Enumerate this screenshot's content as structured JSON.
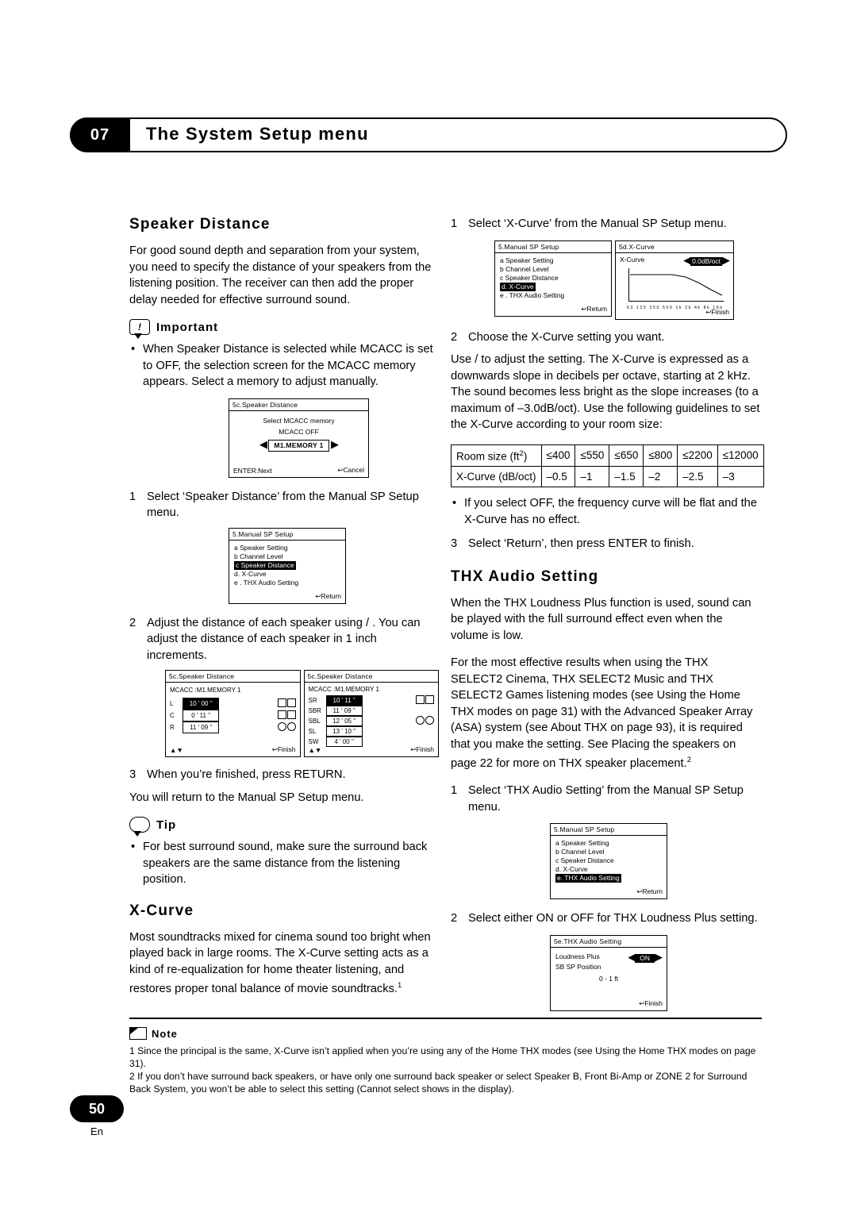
{
  "header": {
    "chapter": "07",
    "title": "The System Setup menu"
  },
  "page": {
    "number": "50",
    "lang": "En"
  },
  "left": {
    "speaker_distance": {
      "heading": "Speaker Distance",
      "intro": "For good sound depth and separation from your system, you need to specify the distance of your speakers from the listening position. The receiver can then add the proper delay needed for effective surround sound.",
      "important_label": "Important",
      "important_bullet": "When Speaker Distance is selected while MCACC is set to OFF, the selection screen for the MCACC memory appears. Select a memory to adjust manually.",
      "mcacc_screen": {
        "title": "5c.Speaker Distance",
        "line1": "Select MCACC memory",
        "memory": "M1.MEMORY 1",
        "off": "MCACC  OFF",
        "enter": "ENTER:Next",
        "cancel": "Cancel"
      },
      "step1": {
        "num": "1",
        "text": "Select ‘Speaker Distance’ from the Manual SP Setup menu."
      },
      "menu_screen": {
        "title": "5.Manual SP Setup",
        "a": "a Speaker Setting",
        "b": "b Channel Level",
        "c": "c Speaker Distance",
        "d": "d. X-Curve",
        "e": "e . THX  Audio  Setting",
        "return": "Return"
      },
      "step2": {
        "num": "2",
        "text": "Adjust the distance of each speaker using  /  . You can adjust the distance of each speaker in 1 inch increments."
      },
      "dist_screen_left": {
        "title": "5c.Speaker Distance",
        "mcacc": "MCACC  :M1.MEMORY  1",
        "rows": [
          {
            "label": "L",
            "value": "10 ' 00 ''",
            "sel": true
          },
          {
            "label": "C",
            "value": "0 ' 11 ''",
            "sel": false
          },
          {
            "label": "R",
            "value": "11 ' 09 ''",
            "sel": false
          }
        ],
        "finish": "Finish"
      },
      "dist_screen_right": {
        "title": "5c.Speaker Distance",
        "mcacc": "MCACC  :M1.MEMORY  1",
        "rows": [
          {
            "label": "SR",
            "value": "10 ' 11 ''",
            "sel": true
          },
          {
            "label": "SBR",
            "value": "11 ' 09 ''",
            "sel": false
          },
          {
            "label": "SBL",
            "value": "12 ' 05 ''",
            "sel": false
          },
          {
            "label": "SL",
            "value": "13 ' 10 ''",
            "sel": false
          },
          {
            "label": "SW",
            "value": "4 ' 00 ''",
            "sel": false
          }
        ],
        "finish": "Finish"
      },
      "step3": {
        "num": "3",
        "text": "When you’re finished, press RETURN."
      },
      "step3_after": "You will return to the Manual SP Setup menu.",
      "tip_label": "Tip",
      "tip_bullet": "For best surround sound, make sure the surround back speakers are the same distance from the listening position."
    },
    "x_curve": {
      "heading": "X-Curve",
      "body": "Most soundtracks mixed for cinema sound too bright when played back in large rooms. The X-Curve setting acts as a kind of re-equalization for home theater listening, and restores proper tonal balance of movie soundtracks.",
      "footnote_marker": "1"
    }
  },
  "right": {
    "x_curve_steps": {
      "step1": {
        "num": "1",
        "text": "Select ‘X-Curve’ from the Manual SP Setup menu."
      },
      "menu_screen": {
        "title": "5.Manual SP Setup",
        "a": "a Speaker Setting",
        "b": "b Channel Level",
        "c": "c Speaker Distance",
        "d": "d. X-Curve",
        "e": "e . THX  Audio  Setting",
        "return": "Return"
      },
      "xcurve_screen": {
        "title": "5d.X-Curve",
        "label": "X-Curve",
        "value": "0.0dB/oct",
        "ticks": "63  125  250  500  1k  2k  4k  8k  16k",
        "finish": "Finish"
      },
      "step2": {
        "num": "2",
        "text": "Choose the X-Curve setting you want."
      },
      "step2_body": "Use  /  to adjust the setting. The X-Curve is expressed as a downwards slope in decibels per octave, starting at 2 kHz. The sound becomes less bright as the slope increases (to a maximum of –3.0dB/oct). Use the following guidelines to set the X-Curve according to your room size:",
      "table": {
        "row1_label": "Room size (ft",
        "row1_sup": "2",
        "row1_label_end": ")",
        "row2_label": "X-Curve (dB/oct)",
        "sizes": [
          "≤400",
          "≤550",
          "≤650",
          "≤800",
          "≤2200",
          "≤12000"
        ],
        "values": [
          "–0.5",
          "–1",
          "–1.5",
          "–2",
          "–2.5",
          "–3"
        ]
      },
      "bullet": "If you select OFF, the frequency curve will be flat and the X-Curve has no effect.",
      "step3": {
        "num": "3",
        "text": "Select ‘Return’, then press ENTER to finish."
      }
    },
    "thx": {
      "heading": "THX Audio Setting",
      "p1": "When the THX Loudness Plus function is used, sound can be played with the full surround effect even when the volume is low.",
      "p2": "For the most effective results when using the THX SELECT2 Cinema, THX SELECT2 Music and THX SELECT2 Games listening modes (see Using the Home THX modes on page 31) with the Advanced Speaker Array (ASA) system (see About THX on page 93), it is required that you make the setting. See Placing the speakers on page 22 for more on THX speaker placement.",
      "p2_sup": "2",
      "step1": {
        "num": "1",
        "text": "Select ‘THX Audio Setting’ from the Manual SP Setup menu."
      },
      "menu_screen": {
        "title": "5.Manual SP Setup",
        "a": "a Speaker Setting",
        "b": "b Channel Level",
        "c": "c Speaker Distance",
        "d": "d. X-Curve",
        "e": "e. THX  Audio  Setting",
        "return": "Return"
      },
      "step2": {
        "num": "2",
        "text": "Select either ON or OFF for THX Loudness Plus setting."
      },
      "thx_screen": {
        "title": "5e.THX  Audio  Setting",
        "line1": "Loudness Plus",
        "value": "ON",
        "line2": "SB SP Position",
        "line3": "0 - 1 ft",
        "finish": "Finish"
      }
    }
  },
  "note": {
    "label": "Note",
    "line1": "1 Since the principal is the same, X-Curve isn’t applied when you’re using any of the Home THX modes (see Using the Home THX modes on page 31).",
    "line2": "2 If you don’t have surround back speakers, or have only one surround back speaker or select Speaker B, Front Bi-Amp or ZONE 2 for Surround Back System, you won’t be able to select this setting (Cannot select shows in the display)."
  }
}
